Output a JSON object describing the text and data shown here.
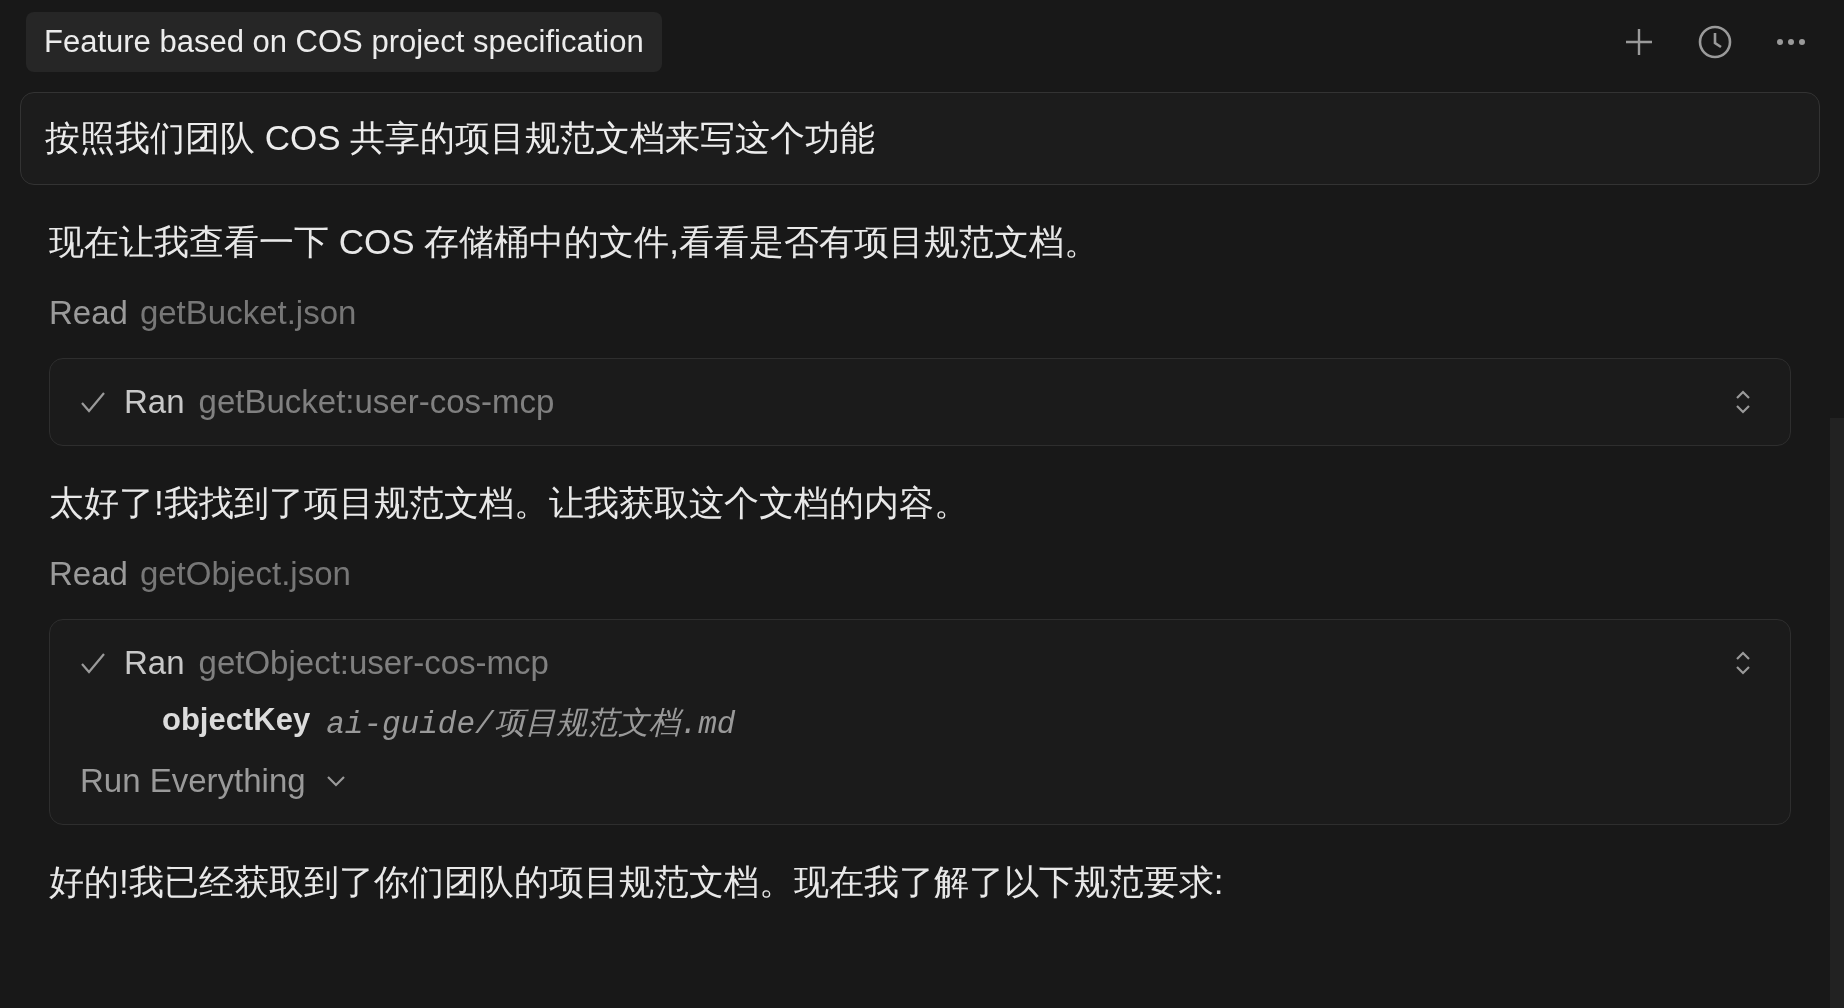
{
  "conversation_title": "Feature based on COS project specification",
  "user_message": "按照我们团队 COS 共享的项目规范文档来写这个功能",
  "steps": [
    {
      "kind": "text",
      "text": "现在让我查看一下 COS 存储桶中的文件,看看是否有项目规范文档。"
    },
    {
      "kind": "read",
      "verb": "Read",
      "file": "getBucket.json"
    },
    {
      "kind": "tool",
      "done": true,
      "verb": "Ran",
      "name": "getBucket:user-cos-mcp"
    },
    {
      "kind": "text",
      "text": "太好了!我找到了项目规范文档。让我获取这个文档的内容。"
    },
    {
      "kind": "read",
      "verb": "Read",
      "file": "getObject.json"
    },
    {
      "kind": "tool",
      "done": true,
      "verb": "Ran",
      "name": "getObject:user-cos-mcp",
      "params": [
        {
          "key": "objectKey",
          "value": "ai-guide/项目规范文档.md"
        }
      ],
      "run_mode": "Run Everything"
    },
    {
      "kind": "text",
      "text": "好的!我已经获取到了你们团队的项目规范文档。现在我了解了以下规范要求:"
    }
  ]
}
